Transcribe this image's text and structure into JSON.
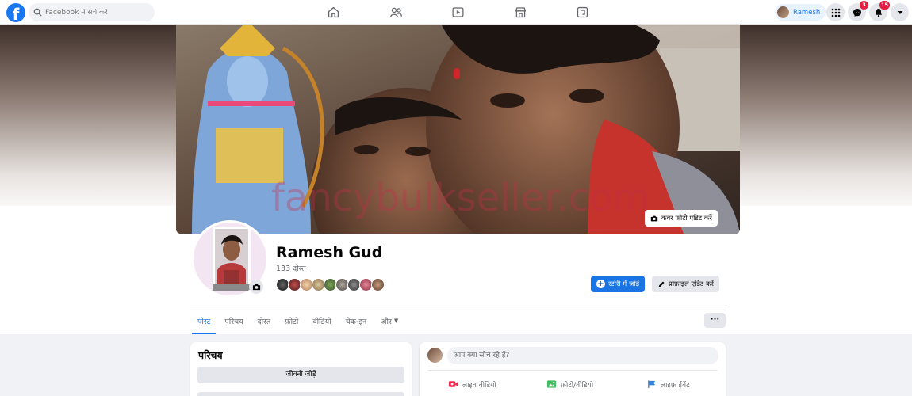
{
  "topbar": {
    "logo": "f",
    "search_placeholder": "Facebook में सर्च करें",
    "user_name": "Ramesh",
    "messenger_badge": "3",
    "notifications_badge": "15"
  },
  "cover": {
    "edit_button": "कवर फ़ोटो एडिट करें"
  },
  "profile": {
    "name": "Ramesh Gud",
    "friends": "133 दोस्त",
    "add_story": "स्टोरी में जोड़ें",
    "edit_profile": "प्रोफ़ाइल एडिट करें"
  },
  "tabs": [
    {
      "label": "पोस्ट"
    },
    {
      "label": "परिचय"
    },
    {
      "label": "दोस्त"
    },
    {
      "label": "फ़ोटो"
    },
    {
      "label": "वीडियो"
    },
    {
      "label": "चेक-इन"
    },
    {
      "label": "और"
    }
  ],
  "more_button": "···",
  "intro": {
    "title": "परिचय",
    "add_bio": "जीवनी जोड़ें"
  },
  "composer": {
    "placeholder": "आप क्या सोच रहे हैं?",
    "live_video": "लाइव वीडियो",
    "photo_video": "फ़ोटो/वीडियो",
    "life_event": "लाइफ़ ईवेंट"
  },
  "colors": {
    "brand": "#1877f2",
    "badge": "#e41e3f",
    "live": "#f02849",
    "photo": "#45bd62",
    "event": "#3b82d6"
  }
}
